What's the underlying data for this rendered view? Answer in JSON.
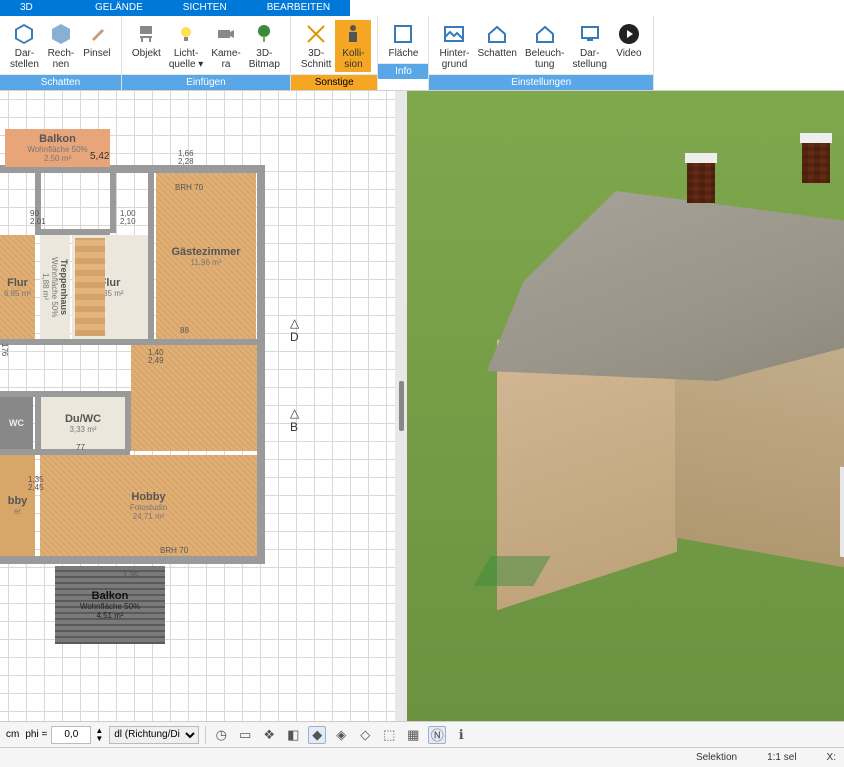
{
  "tabs": [
    {
      "label": "3D",
      "active": true
    },
    {
      "label": "GELÄNDE"
    },
    {
      "label": "SICHTEN"
    },
    {
      "label": "BEARBEITEN"
    }
  ],
  "ribbon": {
    "groups": [
      {
        "label": "Schatten",
        "style": "blue",
        "items": [
          {
            "label": "Dar-\nstellen",
            "icon": "cube"
          },
          {
            "label": "Rech-\nnen",
            "icon": "cube"
          },
          {
            "label": "Pinsel",
            "icon": "brush"
          }
        ]
      },
      {
        "label": "Einfügen",
        "style": "blue",
        "items": [
          {
            "label": "Objekt",
            "icon": "chair"
          },
          {
            "label": "Licht-\nquelle ▾",
            "icon": "bulb"
          },
          {
            "label": "Kame-\nra",
            "icon": "camera"
          },
          {
            "label": "3D-\nBitmap",
            "icon": "tree"
          }
        ]
      },
      {
        "label": "Sonstige",
        "style": "orange",
        "items": [
          {
            "label": "3D-\nSchnitt",
            "icon": "cut"
          },
          {
            "label": "Kolli-\nsion",
            "icon": "person",
            "active": true
          }
        ]
      },
      {
        "label": "Info",
        "style": "blue",
        "items": [
          {
            "label": "Fläche",
            "icon": "area"
          }
        ]
      },
      {
        "label": "Einstellungen",
        "style": "blue",
        "items": [
          {
            "label": "Hinter-\ngrund",
            "icon": "img"
          },
          {
            "label": "Schatten",
            "icon": "house"
          },
          {
            "label": "Beleuch-\ntung",
            "icon": "house"
          },
          {
            "label": "Dar-\nstellung",
            "icon": "screen"
          },
          {
            "label": "Video",
            "icon": "play"
          }
        ]
      }
    ]
  },
  "rooms": {
    "balkon_top": {
      "name": "Balkon",
      "sub": "Wohnfläche 50%",
      "area": "2,50 m²"
    },
    "gaeste": {
      "name": "Gästezimmer",
      "area": "11,96 m²"
    },
    "treppenhaus": {
      "name": "Treppenhaus",
      "sub": "Wohnfläche 50%",
      "area": "1,88 m²"
    },
    "flur1": {
      "name": "Flur",
      "area": "6,85 m²"
    },
    "flur2": {
      "name": "Flur",
      "area": "6,35 m²"
    },
    "wc": {
      "name": "WC"
    },
    "duwc": {
      "name": "Du/WC",
      "area": "3,33 m²"
    },
    "hobby": {
      "name": "Hobby",
      "sub": "Fotostudio",
      "area": "24,71 m²"
    },
    "bby": {
      "name": "bby",
      "sub": "er"
    },
    "balkon_bot": {
      "name": "Balkon",
      "sub": "Wohnfläche 50%",
      "area": "4,51 m²"
    }
  },
  "markers": {
    "d": "D",
    "b": "B",
    "angle": "5,42"
  },
  "dims": {
    "d1": "90",
    "d2": "2,01",
    "d3": "1,00",
    "d4": "2,10",
    "d5": "1,66",
    "d6": "2,28",
    "d7": "BRH 70",
    "d8": "1,40",
    "d9": "2,49",
    "d10": "77",
    "d11": "1,35",
    "d12": "2,45",
    "d13": "1,35",
    "d14": "176",
    "d15": "88"
  },
  "bottombar": {
    "cm": "cm",
    "phi": "phi =",
    "phi_val": "0,0",
    "sel": "dl (Richtung/Di"
  },
  "statusbar": {
    "sel": "Selektion",
    "ratio": "1:1 sel",
    "x": "X:"
  }
}
